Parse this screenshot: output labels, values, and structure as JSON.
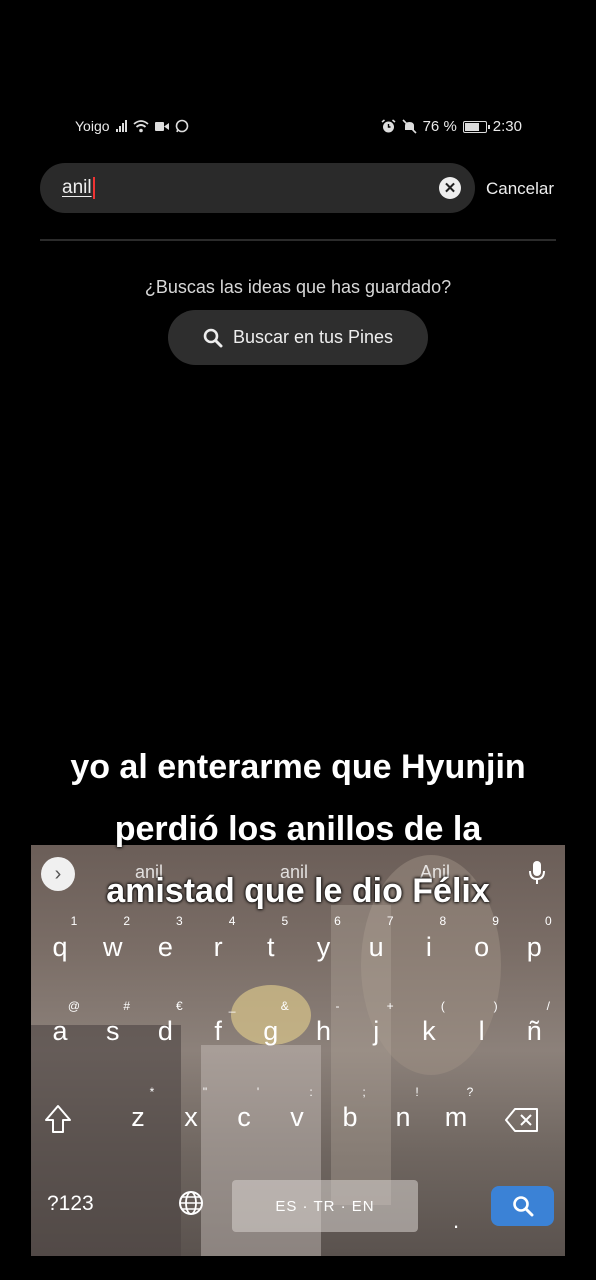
{
  "status_bar": {
    "carrier": "Yoigo",
    "battery": "76 %",
    "battery_level": 0.76,
    "time": "2:30",
    "left_icons": [
      "signal-icon",
      "wifi-icon",
      "video-icon",
      "whatsapp-icon"
    ],
    "right_icons": [
      "alarm-icon",
      "mute-icon",
      "battery-icon"
    ]
  },
  "search": {
    "value": "anil",
    "cancel_label": "Cancelar"
  },
  "saved_prompt": "¿Buscas las ideas que has guardado?",
  "search_pins_label": "Buscar en tus Pines",
  "caption": {
    "line1": "yo al enterarme que Hyunjin",
    "line2": "perdió los anillos de la",
    "line3": "amistad que le dio Félix"
  },
  "keyboard": {
    "suggestions": [
      "anil",
      "anil",
      "Anil"
    ],
    "row1": [
      "q",
      "w",
      "e",
      "r",
      "t",
      "y",
      "u",
      "i",
      "o",
      "p"
    ],
    "row1_hints": [
      "1",
      "2",
      "3",
      "4",
      "5",
      "6",
      "7",
      "8",
      "9",
      "0"
    ],
    "row2": [
      "a",
      "s",
      "d",
      "f",
      "g",
      "h",
      "j",
      "k",
      "l",
      "ñ"
    ],
    "row2_hints": [
      "@",
      "#",
      "€",
      "_",
      "&",
      "-",
      "+",
      "(",
      ")",
      "/"
    ],
    "row3": [
      "z",
      "x",
      "c",
      "v",
      "b",
      "n",
      "m"
    ],
    "row3_hints": [
      "*",
      "\"",
      "'",
      ":",
      ";",
      "!",
      "?"
    ],
    "mode_label": "?123",
    "space_label": "ES · TR · EN",
    "accent_color": "#3b82d6"
  }
}
